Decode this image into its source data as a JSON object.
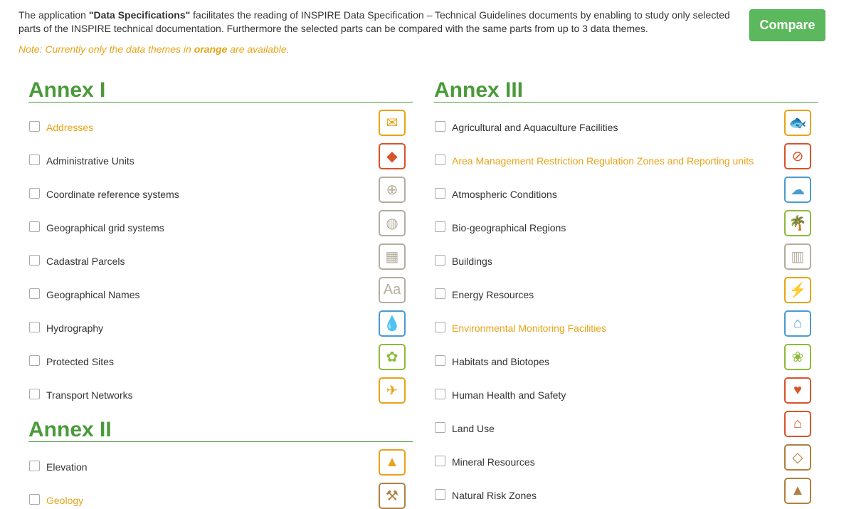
{
  "intro": {
    "part1": "The application ",
    "app_name": "\"Data Specifications\"",
    "part2": " facilitates the reading of INSPIRE Data Specification – Technical Guidelines documents by enabling to study only selected parts of the INSPIRE technical documentation. Furthermore the selected parts can be compared with the same parts from up to 3 data themes."
  },
  "note": {
    "part1": "Note: Currently only the data themes in ",
    "highlight": "orange",
    "part2": " are available."
  },
  "compare_label": "Compare",
  "colors": {
    "accent_green": "#4a9a3a",
    "available_orange": "#e8a317",
    "button_green": "#5cb85c"
  },
  "annex1": {
    "title": "Annex I",
    "themes": [
      {
        "label": "Addresses",
        "available": true,
        "icon": "mailbox-icon",
        "icon_color": "#e8a317",
        "glyph": "✉"
      },
      {
        "label": "Administrative Units",
        "available": false,
        "icon": "europe-map-icon",
        "icon_color": "#d9532b",
        "glyph": "◆"
      },
      {
        "label": "Coordinate reference systems",
        "available": false,
        "icon": "coordinate-globe-icon",
        "icon_color": "#b5ad9e",
        "glyph": "⊕"
      },
      {
        "label": "Geographical grid systems",
        "available": false,
        "icon": "grid-globe-icon",
        "icon_color": "#b5ad9e",
        "glyph": "◍"
      },
      {
        "label": "Cadastral Parcels",
        "available": false,
        "icon": "parcels-icon",
        "icon_color": "#b5ad9e",
        "glyph": "▦"
      },
      {
        "label": "Geographical Names",
        "available": false,
        "icon": "names-icon",
        "icon_color": "#b5ad9e",
        "glyph": "Aa"
      },
      {
        "label": "Hydrography",
        "available": false,
        "icon": "water-drop-icon",
        "icon_color": "#4a9bd0",
        "glyph": "💧"
      },
      {
        "label": "Protected Sites",
        "available": false,
        "icon": "plant-hand-icon",
        "icon_color": "#8fb93a",
        "glyph": "✿"
      },
      {
        "label": "Transport Networks",
        "available": false,
        "icon": "transport-icon",
        "icon_color": "#e8a317",
        "glyph": "✈"
      }
    ]
  },
  "annex2": {
    "title": "Annex II",
    "themes": [
      {
        "label": "Elevation",
        "available": false,
        "icon": "elevation-icon",
        "icon_color": "#e8a317",
        "glyph": "▲"
      },
      {
        "label": "Geology",
        "available": true,
        "icon": "hammer-icon",
        "icon_color": "#b08040",
        "glyph": "⚒"
      }
    ]
  },
  "annex3": {
    "title": "Annex III",
    "themes": [
      {
        "label": "Agricultural and Aquaculture Facilities",
        "available": false,
        "icon": "fish-carrot-icon",
        "icon_color": "#e8a317",
        "glyph": "🐟"
      },
      {
        "label": "Area Management Restriction Regulation Zones and Reporting units",
        "available": true,
        "icon": "restriction-icon",
        "icon_color": "#d9532b",
        "glyph": "⊘"
      },
      {
        "label": "Atmospheric Conditions",
        "available": false,
        "icon": "weather-icon",
        "icon_color": "#4a9bd0",
        "glyph": "☁"
      },
      {
        "label": "Bio-geographical Regions",
        "available": false,
        "icon": "palm-tree-icon",
        "icon_color": "#8fb93a",
        "glyph": "🌴"
      },
      {
        "label": "Buildings",
        "available": false,
        "icon": "building-icon",
        "icon_color": "#b5ad9e",
        "glyph": "▥"
      },
      {
        "label": "Energy Resources",
        "available": false,
        "icon": "wind-turbine-icon",
        "icon_color": "#e8a317",
        "glyph": "⚡"
      },
      {
        "label": "Environmental Monitoring Facilities",
        "available": true,
        "icon": "monitoring-icon",
        "icon_color": "#4a9bd0",
        "glyph": "⌂"
      },
      {
        "label": "Habitats and Biotopes",
        "available": false,
        "icon": "habitat-icon",
        "icon_color": "#8fb93a",
        "glyph": "❀"
      },
      {
        "label": "Human Health and Safety",
        "available": false,
        "icon": "heart-icon",
        "icon_color": "#d9532b",
        "glyph": "♥"
      },
      {
        "label": "Land Use",
        "available": false,
        "icon": "land-use-icon",
        "icon_color": "#d9532b",
        "glyph": "⌂"
      },
      {
        "label": "Mineral Resources",
        "available": false,
        "icon": "diamond-icon",
        "icon_color": "#b08040",
        "glyph": "◇"
      },
      {
        "label": "Natural Risk Zones",
        "available": false,
        "icon": "rockfall-icon",
        "icon_color": "#b08040",
        "glyph": "▲"
      }
    ]
  }
}
